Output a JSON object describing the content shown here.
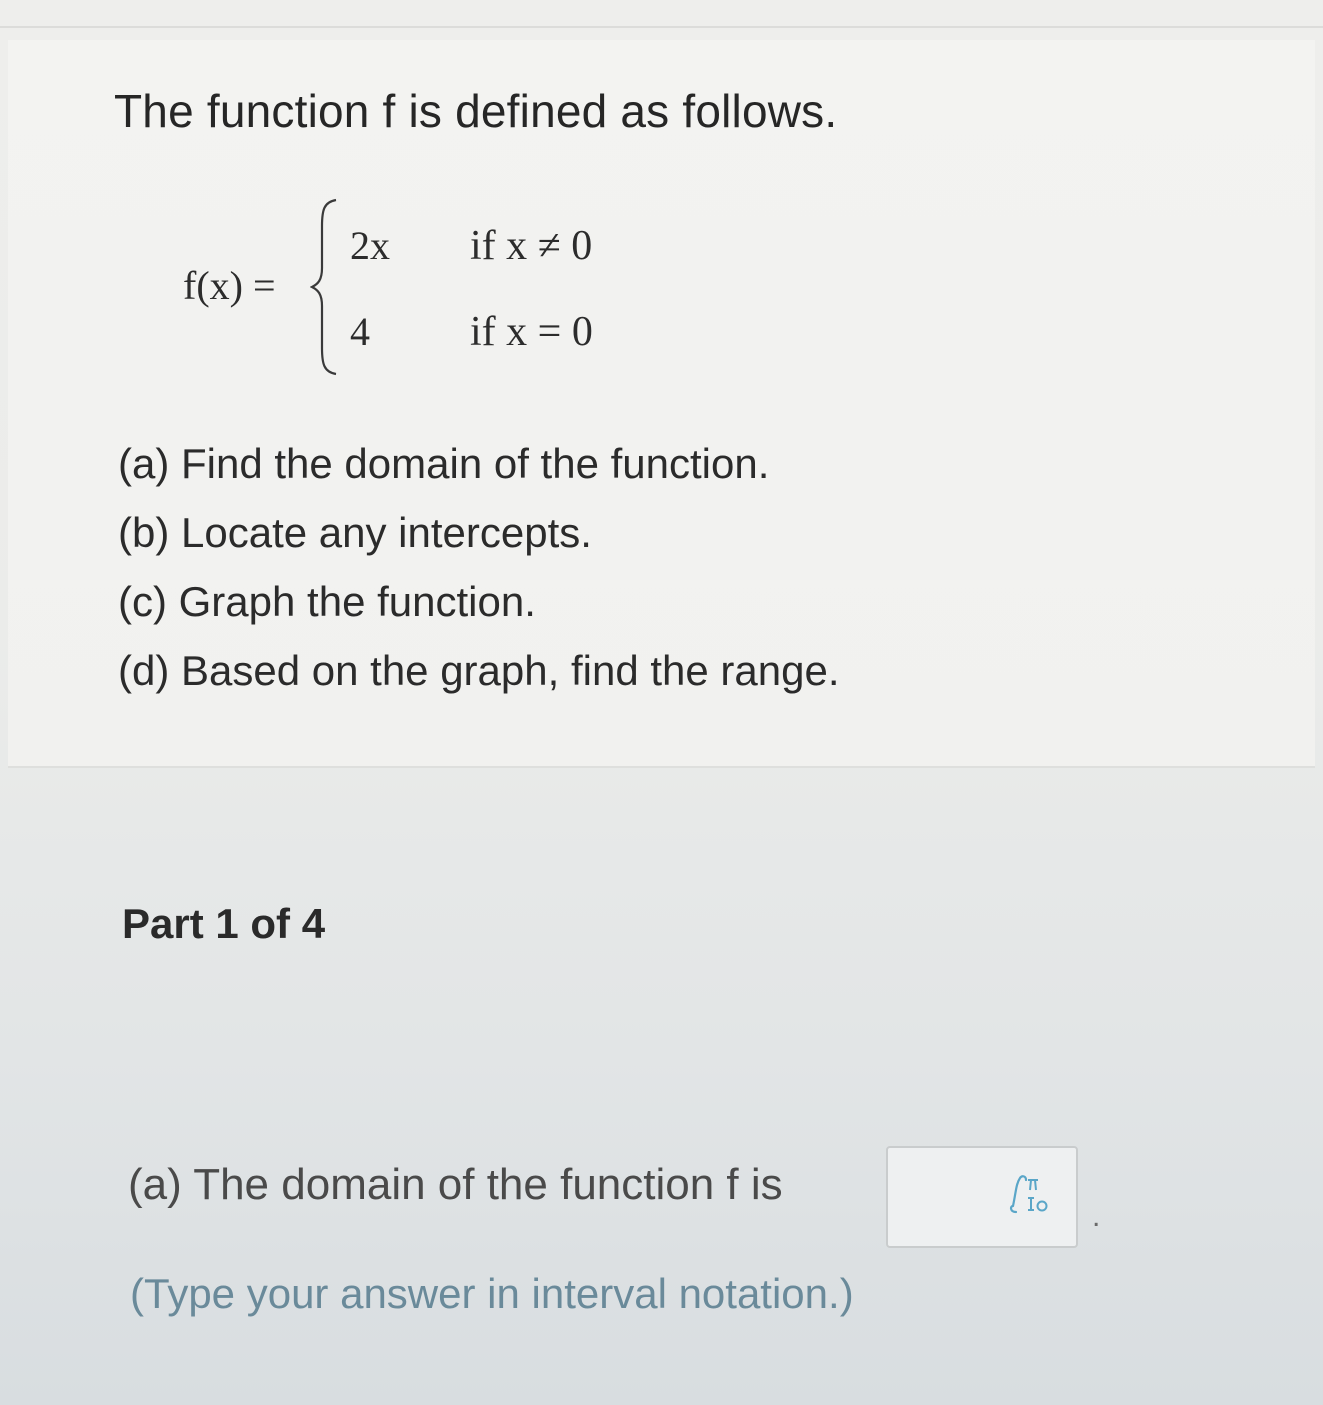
{
  "problem": {
    "intro": "The function f is defined as follows.",
    "function_label": "f(x) =",
    "cases": [
      {
        "expr": "2x",
        "condition": "if x ≠ 0"
      },
      {
        "expr": "4",
        "condition": "if x = 0"
      }
    ],
    "tasks": [
      "(a) Find the domain of the function.",
      "(b) Locate any intercepts.",
      "(c) Graph the function.",
      "(d) Based on the graph, find the range."
    ]
  },
  "part": {
    "header": "Part 1 of 4",
    "prompt": "(a) The domain of the function f is",
    "answer_value": "",
    "trailing_punct": ".",
    "hint": "(Type your answer in interval notation.)",
    "math_palette_icon": "math-palette-icon"
  },
  "colors": {
    "hint_text": "#6a8a9a",
    "icon_accent": "#5aa6c8"
  }
}
